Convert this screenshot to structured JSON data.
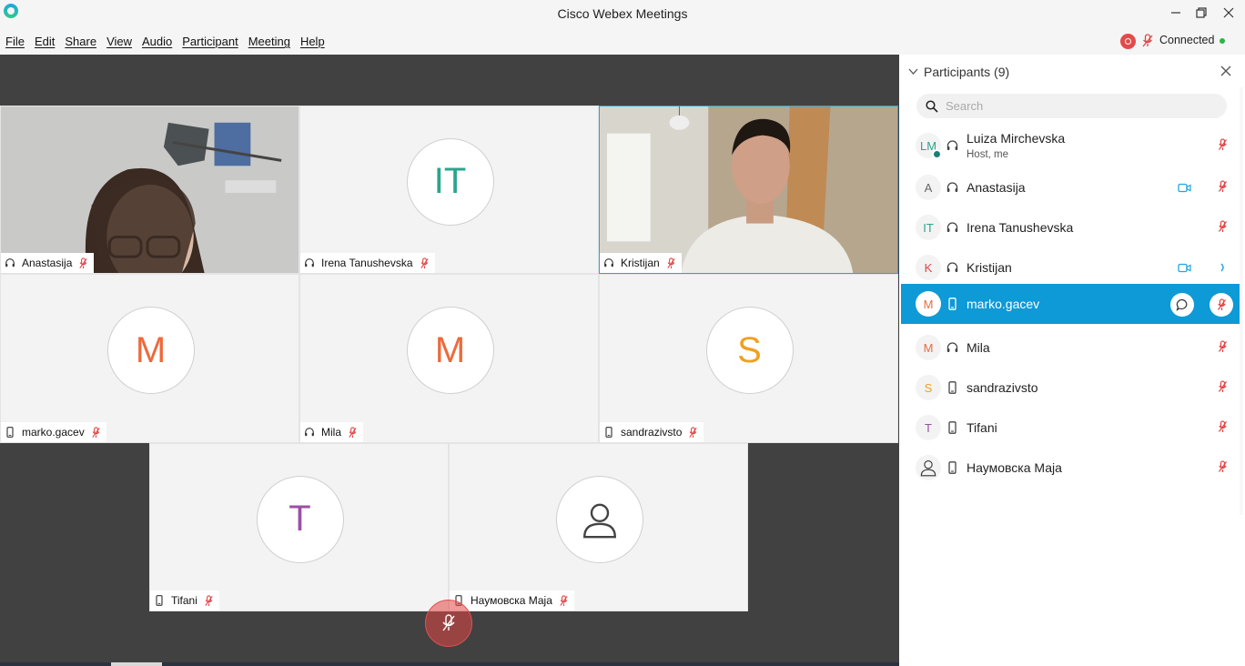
{
  "window": {
    "title": "Cisco Webex Meetings"
  },
  "menu": [
    "File",
    "Edit",
    "Share",
    "View",
    "Audio",
    "Participant",
    "Meeting",
    "Help"
  ],
  "status": {
    "connection": "Connected"
  },
  "colors": {
    "accent": "#1ea7e0",
    "selected_row": "#0d9ad6",
    "mute_red": "#e04545",
    "connected_green": "#2db34a",
    "stage_bg": "#414141"
  },
  "tiles": [
    {
      "name": "Anastasija",
      "type": "video",
      "audio_icon": "headset-icon"
    },
    {
      "name": "Irena Tanushevska",
      "initials": "IT",
      "initials_color": "#2aa58c",
      "audio_icon": "headset-icon"
    },
    {
      "name": "Kristijan",
      "type": "video",
      "active": true,
      "audio_icon": "headset-icon"
    },
    {
      "name": "marko.gacev",
      "initials": "M",
      "initials_color": "#ec6a3c",
      "audio_icon": "phone-icon"
    },
    {
      "name": "Mila",
      "initials": "M",
      "initials_color": "#ec6a3c",
      "audio_icon": "headset-icon"
    },
    {
      "name": "sandrazivsto",
      "initials": "S",
      "initials_color": "#f0a020",
      "audio_icon": "phone-icon"
    },
    {
      "name": "Tifani",
      "initials": "T",
      "initials_color": "#9b4fa6",
      "audio_icon": "phone-icon"
    },
    {
      "name": "Наумовска Маја",
      "avatar_icon": "person-icon",
      "audio_icon": "phone-icon"
    }
  ],
  "panel": {
    "title": "Participants (9)",
    "search_placeholder": "Search",
    "participants": [
      {
        "initials": "LM",
        "initials_color": "#2aa58c",
        "name": "Luiza Mirchevska",
        "subtitle": "Host, me",
        "audio_icon": "headset-icon",
        "status": "muted"
      },
      {
        "initials": "A",
        "initials_color": "#666666",
        "name": "Anastasija",
        "audio_icon": "headset-icon",
        "video": true,
        "status": "muted"
      },
      {
        "initials": "IT",
        "initials_color": "#2aa58c",
        "name": "Irena Tanushevska",
        "audio_icon": "headset-icon",
        "status": "muted"
      },
      {
        "initials": "K",
        "initials_color": "#e04545",
        "name": "Kristijan",
        "audio_icon": "headset-icon",
        "video": true,
        "status": "speaking"
      },
      {
        "initials": "M",
        "initials_color": "#ec6a3c",
        "name": "marko.gacev",
        "audio_icon": "phone-icon",
        "status": "muted",
        "selected": true
      },
      {
        "initials": "M",
        "initials_color": "#ec6a3c",
        "name": "Mila",
        "audio_icon": "headset-icon",
        "status": "muted"
      },
      {
        "initials": "S",
        "initials_color": "#f0a020",
        "name": "sandrazivsto",
        "audio_icon": "phone-icon",
        "status": "muted"
      },
      {
        "initials": "T",
        "initials_color": "#9b4fa6",
        "name": "Tifani",
        "audio_icon": "phone-icon",
        "status": "muted"
      },
      {
        "avatar_icon": "person-icon",
        "name": "Наумовска Маја",
        "audio_icon": "phone-icon",
        "status": "muted"
      }
    ]
  }
}
